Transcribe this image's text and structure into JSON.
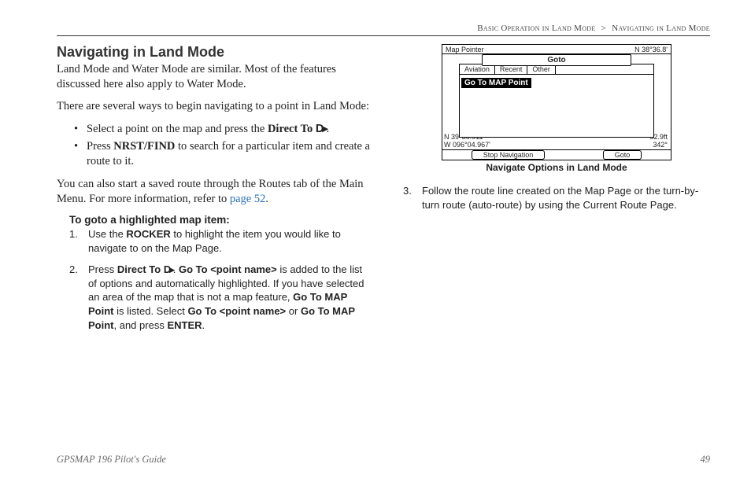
{
  "breadcrumb": {
    "section": "Basic Operation in Land Mode",
    "sep": ">",
    "page": "Navigating in Land Mode"
  },
  "title": "Navigating in Land Mode",
  "intro1": "Land Mode and Water Mode are similar. Most of the features discussed here also apply to Water Mode.",
  "intro2": "There are several ways to begin navigating to a point in Land Mode:",
  "bullets": {
    "b1_a": "Select a point on the map and press the ",
    "b1_b": "Direct To ",
    "b1_icon": "D▸",
    "b1_c": ".",
    "b2_a": "Press ",
    "b2_b": "NRST/FIND",
    "b2_c": " to search for a particular item and create a route to it."
  },
  "para2_a": "You can also start a saved route through the Routes tab of the Main Menu. For more information, refer to ",
  "para2_link": "page 52",
  "para2_b": ".",
  "steps_title": "To goto a highlighted map item:",
  "steps": {
    "s1_num": "1.",
    "s1_a": "Use the ",
    "s1_b": "ROCKER",
    "s1_c": " to highlight the item you would like to navigate to on the Map Page.",
    "s2_num": "2.",
    "s2_a": "Press ",
    "s2_b": "Direct To ",
    "s2_icon": "D▸",
    "s2_c": ". ",
    "s2_d": "Go To <point name>",
    "s2_e": " is added to the list of options and automatically highlighted. If you have selected an area of the map that is not a map feature, ",
    "s2_f": "Go To MAP Point",
    "s2_g": " is listed. Select ",
    "s2_h": "Go To <point name>",
    "s2_i": " or ",
    "s2_j": "Go To MAP Point",
    "s2_k": ", and press ",
    "s2_l": "ENTER",
    "s2_m": "."
  },
  "figure": {
    "top_left": "Map Pointer",
    "top_right": "N   38°36.8'",
    "titlebar": "Goto",
    "tab1": "Aviation",
    "tab2": "Recent",
    "tab3": "Other",
    "highlight": "Go To MAP Point",
    "coord1": "N  39°36.911'",
    "coord2": "W 096°04.967'",
    "coord_r1": "52.9ft",
    "coord_r2": "342°",
    "btn_left": "Stop Navigation",
    "btn_right": "Goto",
    "caption": "Navigate Options in Land Mode"
  },
  "right_step": {
    "num": "3.",
    "text": "Follow the route line created on the Map Page or the turn-by-turn route (auto-route) by using the Current Route Page."
  },
  "footer": {
    "guide": "GPSMAP 196 Pilot's Guide",
    "page": "49"
  }
}
